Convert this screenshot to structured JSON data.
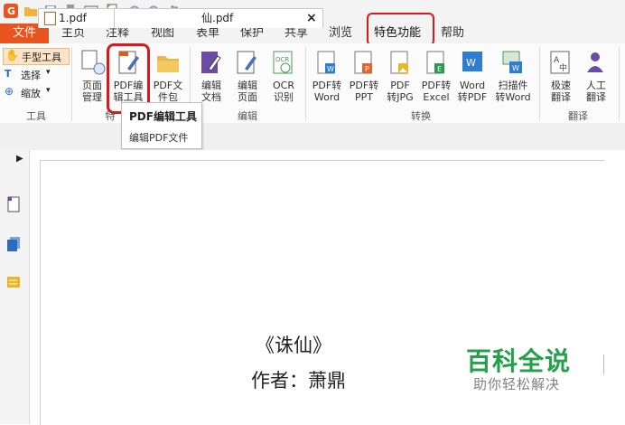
{
  "menu": {
    "file": "文件",
    "items": [
      "主页",
      "注释",
      "视图",
      "表单",
      "保护",
      "共享",
      "浏览",
      "特色功能",
      "帮助"
    ]
  },
  "tools_group": {
    "hand": "手型工具",
    "select": "选择",
    "zoom": "缩放",
    "label": "工具"
  },
  "ribbon": {
    "page_manage": [
      "页面",
      "管理"
    ],
    "pdf_edit_tool": [
      "PDF编",
      "辑工具"
    ],
    "pdf_package": [
      "PDF文",
      "件包"
    ],
    "edit_doc": [
      "编辑",
      "文档"
    ],
    "edit_page": [
      "编辑",
      "页面"
    ],
    "ocr": [
      "OCR",
      "识别"
    ],
    "to_word": [
      "PDF转",
      "Word"
    ],
    "to_ppt": [
      "PDF转",
      "PPT"
    ],
    "to_jpg": [
      "PDF",
      "转JPG"
    ],
    "to_excel": [
      "PDF转",
      "Excel"
    ],
    "word_to_pdf": [
      "Word",
      "转PDF"
    ],
    "scan_to_word": [
      "扫描件",
      "转Word"
    ],
    "fast_translate": [
      "极速",
      "翻译"
    ],
    "human_translate": [
      "人工",
      "翻译"
    ],
    "group_special": "特",
    "group_edit": "编辑",
    "group_convert": "转换",
    "group_translate": "翻译"
  },
  "tooltip": {
    "title": "PDF编辑工具",
    "desc": "编辑PDF文件"
  },
  "tabs": {
    "tab1": "1.pdf",
    "tab2_partial": "仙.pdf",
    "close": "×"
  },
  "document": {
    "title": "《诛仙》",
    "author": "作者：萧鼎"
  },
  "watermark": {
    "title": "百科全说",
    "subtitle": "助你轻松解决"
  },
  "colors": {
    "accent_orange": "#e8541e",
    "highlight_red": "#d9191e",
    "watermark_green": "#25a04a"
  }
}
